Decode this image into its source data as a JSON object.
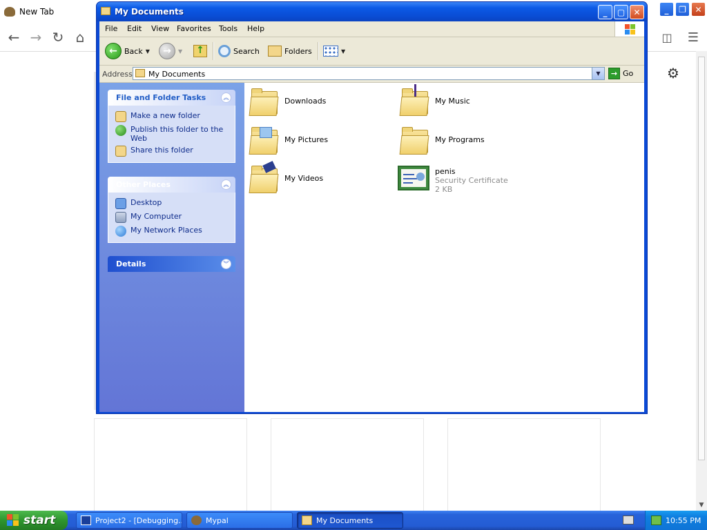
{
  "browser": {
    "tab_title": "New Tab",
    "tiles": 3
  },
  "window": {
    "title": "My Documents",
    "menu": [
      "File",
      "Edit",
      "View",
      "Favorites",
      "Tools",
      "Help"
    ],
    "toolbar": {
      "back": "Back",
      "search": "Search",
      "folders": "Folders"
    },
    "address": {
      "label": "Address",
      "value": "My Documents",
      "go": "Go"
    },
    "tasks_panel": {
      "title": "File and Folder Tasks",
      "items": [
        "Make a new folder",
        "Publish this folder to the Web",
        "Share this folder"
      ]
    },
    "places_panel": {
      "title": "Other Places",
      "items": [
        "Desktop",
        "My Computer",
        "My Network Places"
      ]
    },
    "details_panel": {
      "title": "Details"
    },
    "files": [
      {
        "name": "Downloads"
      },
      {
        "name": "My Music"
      },
      {
        "name": "My Pictures"
      },
      {
        "name": "My Programs"
      },
      {
        "name": "My Videos"
      },
      {
        "name": "penis",
        "type": "Security Certificate",
        "size": "2 KB"
      }
    ]
  },
  "taskbar": {
    "start": "start",
    "buttons": [
      "Project2 - [Debugging...",
      "Mypal",
      "My Documents"
    ],
    "clock": "10:55 PM"
  }
}
